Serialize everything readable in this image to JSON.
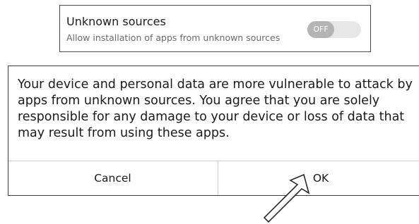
{
  "settings_row": {
    "title": "Unknown sources",
    "subtitle": "Allow installation of apps from unknown sources",
    "toggle_state": "OFF"
  },
  "dialog": {
    "message": "Your device and personal data are more vulnerable to attack by apps from unknown sources. You agree that you are solely responsible for any damage to your device or loss of data that may result from using these apps.",
    "cancel_label": "Cancel",
    "ok_label": "OK"
  },
  "annotation": {
    "arrow_icon": "outline-arrow-pointing-up-right",
    "target": "ok-button"
  },
  "colors": {
    "toggle_track": "#e7e7e7",
    "toggle_knob": "#b4b4b4",
    "border": "#3a3a3a",
    "text": "#1a1a1a",
    "subtext": "#6a6a6a"
  }
}
